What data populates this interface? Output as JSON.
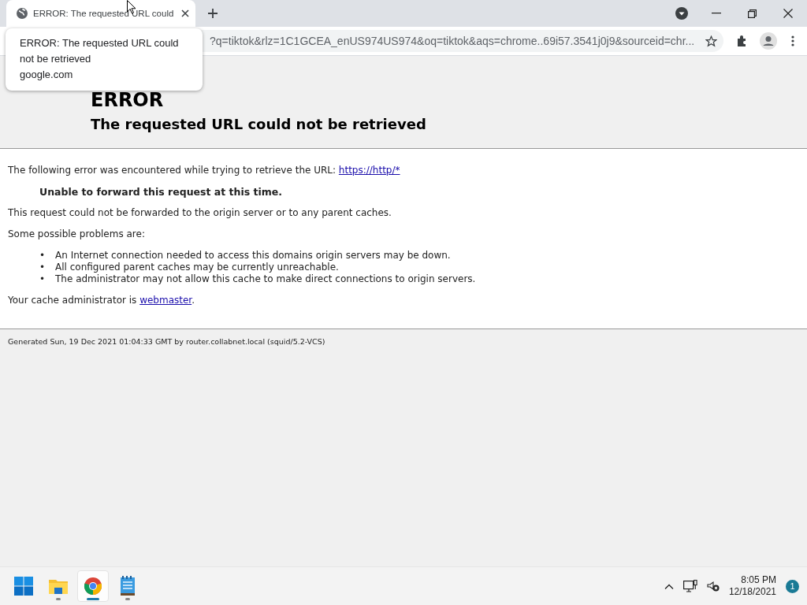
{
  "tab": {
    "title": "ERROR: The requested URL could",
    "selected": true
  },
  "tab_tooltip": {
    "title": "ERROR: The requested URL could not be retrieved",
    "domain": "google.com"
  },
  "address_bar": {
    "value": "?q=tiktok&rlz=1C1GCEA_enUS974US974&oq=tiktok&aqs=chrome..69i57.3541j0j9&sourceid=chr..."
  },
  "page": {
    "heading": "ERROR",
    "subheading": "The requested URL could not be retrieved",
    "intro": "The following error was encountered while trying to retrieve the URL: ",
    "intro_link": "https://http/*",
    "error_message": "Unable to forward this request at this time.",
    "explanation": "This request could not be forwarded to the origin server or to any parent caches.",
    "problems_label": "Some possible problems are:",
    "problems": [
      {
        "marker": "•",
        "text": "An Internet connection needed to access this domains origin servers may be down."
      },
      {
        "marker": "•",
        "text": "All configured parent caches may be currently unreachable."
      },
      {
        "marker": "•",
        "text": "The administrator may not allow this cache to make direct connections to origin servers."
      }
    ],
    "admin_text": "Your cache administrator is ",
    "admin_link": "webmaster",
    "admin_end": ".",
    "footer": "Generated Sun, 19 Dec 2021 01:04:33 GMT by router.collabnet.local (squid/5.2-VCS)"
  },
  "taskbar": {
    "apps": [
      {
        "kind": "start",
        "running": false,
        "active": false
      },
      {
        "kind": "folder",
        "running": true,
        "active": false
      },
      {
        "kind": "chrome",
        "running": true,
        "active": true
      },
      {
        "kind": "notepad",
        "running": true,
        "active": false
      }
    ],
    "time": "8:05 PM",
    "date": "12/18/2021",
    "notifications": "1"
  }
}
